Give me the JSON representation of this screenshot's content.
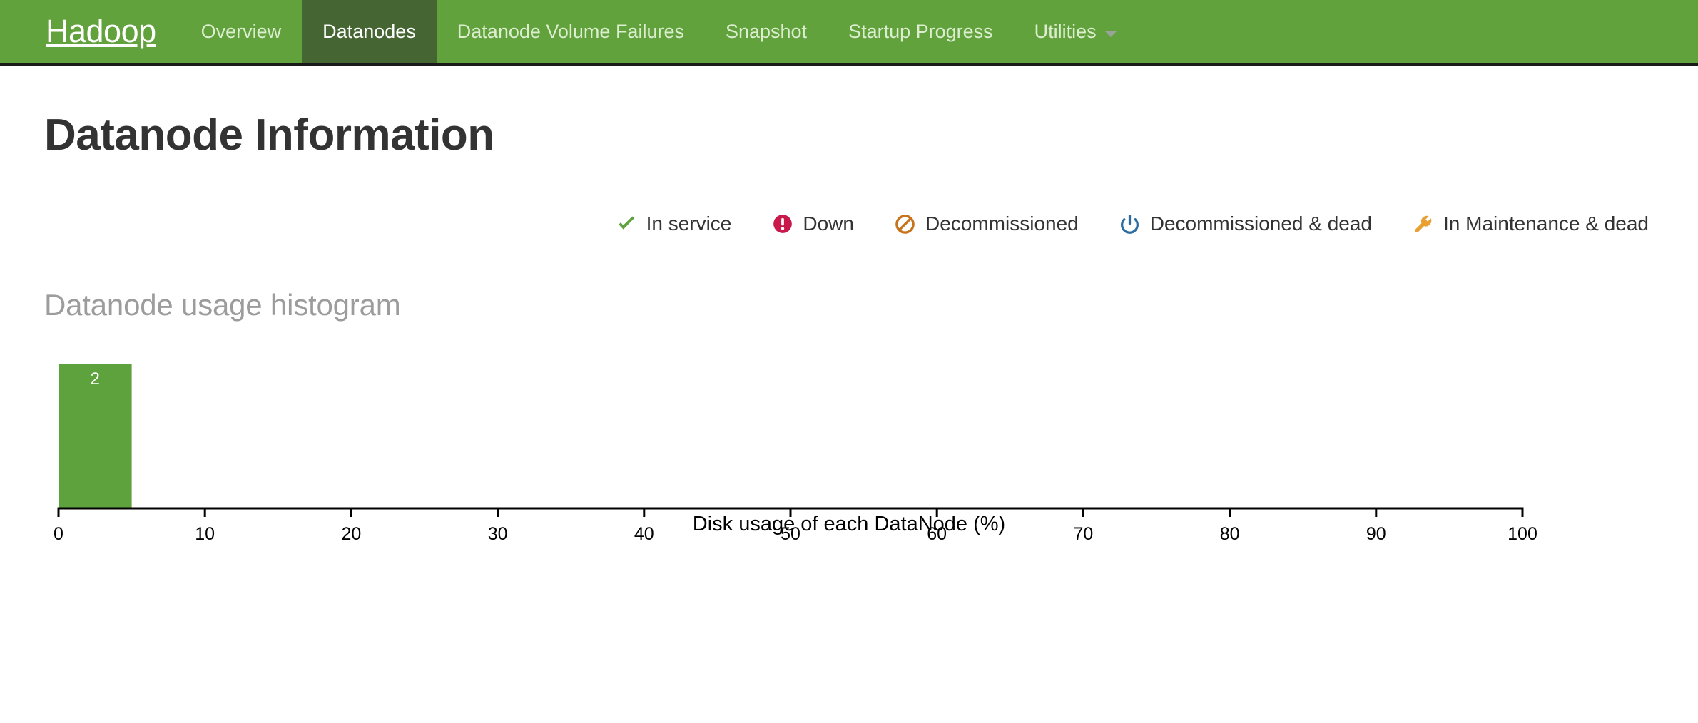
{
  "navbar": {
    "brand": "Hadoop",
    "items": [
      {
        "label": "Overview",
        "active": false,
        "icon": ""
      },
      {
        "label": "Datanodes",
        "active": true,
        "icon": ""
      },
      {
        "label": "Datanode Volume Failures",
        "active": false,
        "icon": ""
      },
      {
        "label": "Snapshot",
        "active": false,
        "icon": ""
      },
      {
        "label": "Startup Progress",
        "active": false,
        "icon": ""
      },
      {
        "label": "Utilities",
        "active": false,
        "icon": "chevron-down-icon"
      }
    ],
    "background_color": "#61a23c",
    "active_color": "#456632"
  },
  "page": {
    "title": "Datanode Information"
  },
  "legend": {
    "items": [
      {
        "label": "In service",
        "icon": "check-icon",
        "color": "#5da23d"
      },
      {
        "label": "Down",
        "icon": "alert-circle-icon",
        "color": "#c9184a"
      },
      {
        "label": "Decommissioned",
        "icon": "ban-circle-icon",
        "color": "#c8721a"
      },
      {
        "label": "Decommissioned & dead",
        "icon": "power-icon",
        "color": "#2b6ca3"
      },
      {
        "label": "In Maintenance & dead",
        "icon": "wrench-icon",
        "color": "#e8a033"
      }
    ]
  },
  "histogram": {
    "panel_title": "Datanode usage histogram"
  },
  "chart_data": {
    "type": "bar",
    "title": "Datanode usage histogram",
    "xlabel": "Disk usage of each DataNode (%)",
    "ylabel": "",
    "xlim": [
      0,
      100
    ],
    "ylim": [
      0,
      2
    ],
    "grid": false,
    "legend_position": "none",
    "bar_color": "#5da23d",
    "xticks": [
      0,
      10,
      20,
      30,
      40,
      50,
      60,
      70,
      80,
      90,
      100
    ],
    "xtick_labels": [
      "0",
      "10",
      "20",
      "30",
      "40",
      "50",
      "60",
      "70",
      "80",
      "90",
      "100"
    ],
    "bins": [
      {
        "x_start": 0,
        "x_end": 5,
        "value": 2,
        "label": "2"
      }
    ],
    "categories": [
      "0-5"
    ],
    "values": [
      2
    ]
  }
}
